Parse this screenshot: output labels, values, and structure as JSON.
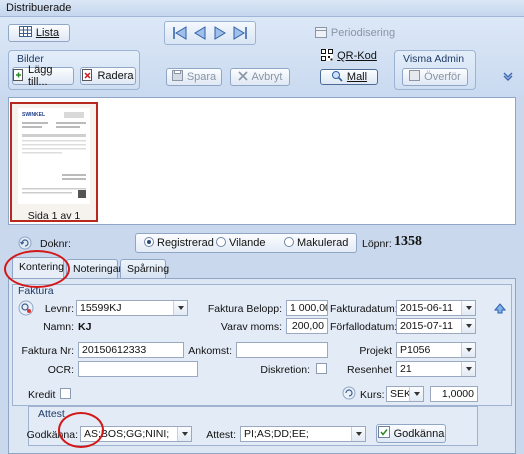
{
  "window": {
    "title": "Distribuerade"
  },
  "toolbar": {
    "lista_label": "Lista",
    "bilder_group_label": "Bilder",
    "lagg_till_label": "Lägg till...",
    "radera_label": "Radera",
    "spara_label": "Spara",
    "avbryt_label": "Avbryt",
    "periodisering_label": "Periodisering",
    "qr_kod_label": "QR-Kod",
    "mall_label": "Mall",
    "visma_admin_group_label": "Visma Admin",
    "overfor_label": "Överför"
  },
  "thumbnail": {
    "caption": "Sida 1 av 1",
    "brand": "SWINKEL"
  },
  "status": {
    "doknr_label": "Doknr:",
    "radio_options": [
      "Registrerad",
      "Vilande",
      "Makulerad"
    ],
    "selected": "Registrerad",
    "lopnr_label": "Löpnr:",
    "lopnr_value": "1358"
  },
  "tabs": [
    "Kontering",
    "Noteringar",
    "Spårning"
  ],
  "faktura": {
    "section_label": "Faktura",
    "levnr_label": "Levnr:",
    "levnr_value": "15599KJ",
    "namn_label": "Namn:",
    "namn_value": "KJ",
    "belopp_label": "Faktura Belopp:",
    "belopp_value": "1 000,00",
    "moms_label": "Varav moms:",
    "moms_value": "200,00",
    "fakturadatum_label": "Fakturadatum:",
    "fakturadatum_value": "2015-06-11",
    "forfallodatum_label": "Förfallodatum:",
    "forfallodatum_value": "2015-07-11",
    "faktura_nr_label": "Faktura Nr:",
    "faktura_nr_value": "20150612333",
    "ankomst_label": "Ankomst:",
    "ankomst_value": "",
    "projekt_label": "Projekt",
    "projekt_value": "P1056",
    "ocr_label": "OCR:",
    "ocr_value": "",
    "diskretion_label": "Diskretion:",
    "resenhet_label": "Resenhet",
    "resenhet_value": "21",
    "kredit_label": "Kredit",
    "kurs_label": "Kurs:",
    "currency_value": "SEK",
    "kurs_value": "1,0000"
  },
  "attest": {
    "section_label": "Attest",
    "godkanna_label": "Godkänna:",
    "godkanna_value": "AS;BOS;GG;NINI;",
    "attest_label": "Attest:",
    "attest_value": "PI;AS;DD;EE;",
    "godkanna_button_label": "Godkänna"
  },
  "colors": {
    "highlight_ring": "#d31818",
    "thumb_border": "#b7281f"
  }
}
